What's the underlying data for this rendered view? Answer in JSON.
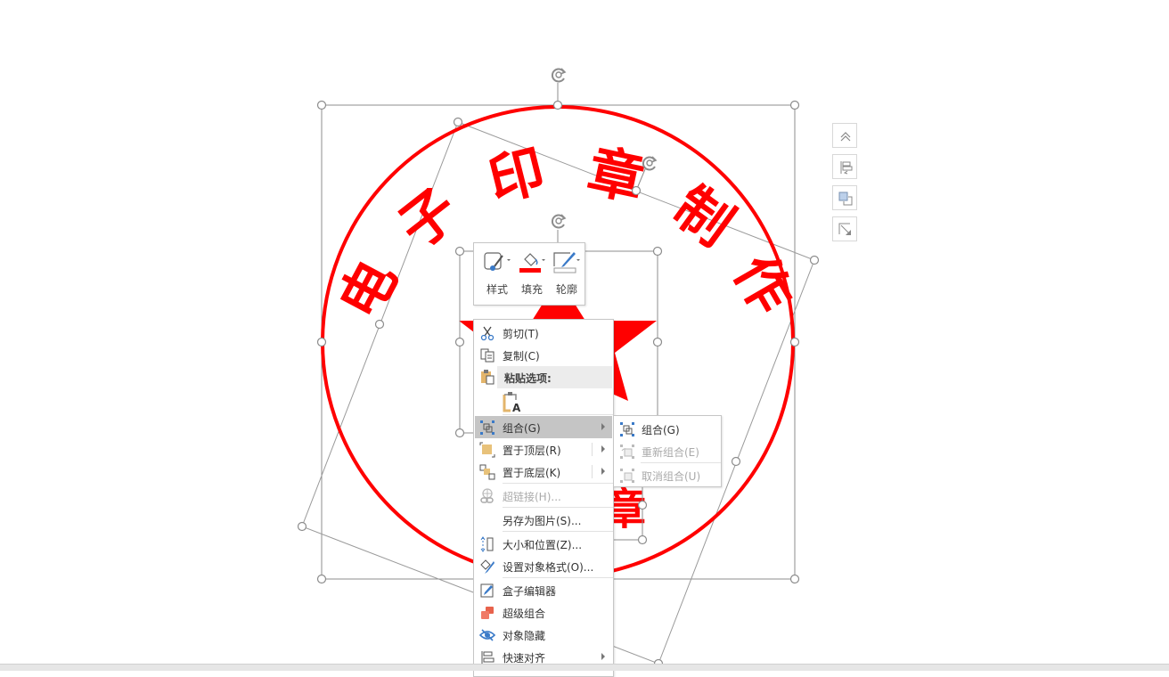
{
  "stamp": {
    "arc_text": [
      "电",
      "子",
      "印",
      "章",
      "制",
      "作"
    ],
    "center_text_partial": "章",
    "color": "#ff0000"
  },
  "mini_toolbar": {
    "buttons": [
      {
        "label": "样式",
        "icon": "shape-style-icon"
      },
      {
        "label": "填充",
        "icon": "fill-bucket-icon",
        "color": "#ff0000"
      },
      {
        "label": "轮廓",
        "icon": "outline-pen-icon"
      }
    ]
  },
  "context_menu": {
    "items": [
      {
        "label": "剪切(T)",
        "icon": "scissors-icon"
      },
      {
        "label": "复制(C)",
        "icon": "copy-icon"
      },
      {
        "label": "粘贴选项:",
        "icon": "paste-icon",
        "header": true
      },
      {
        "label": "",
        "icon": "paste-text-only-icon"
      },
      {
        "label": "组合(G)",
        "icon": "group-icon",
        "submenu": true,
        "highlighted": true
      },
      {
        "label": "置于顶层(R)",
        "icon": "bring-to-front-icon",
        "submenu": true
      },
      {
        "label": "置于底层(K)",
        "icon": "send-to-back-icon",
        "submenu": true
      },
      {
        "label": "超链接(H)...",
        "icon": "hyperlink-icon",
        "disabled": true
      },
      {
        "label": "另存为图片(S)...",
        "icon": ""
      },
      {
        "label": "大小和位置(Z)...",
        "icon": "size-position-icon"
      },
      {
        "label": "设置对象格式(O)...",
        "icon": "format-object-icon"
      },
      {
        "label": "盒子编辑器",
        "icon": "box-editor-icon"
      },
      {
        "label": "超级组合",
        "icon": "super-group-icon"
      },
      {
        "label": "对象隐藏",
        "icon": "hide-object-icon"
      },
      {
        "label": "快速对齐",
        "icon": "quick-align-icon",
        "submenu": true
      }
    ]
  },
  "group_submenu": {
    "items": [
      {
        "label": "组合(G)",
        "icon": "group-icon"
      },
      {
        "label": "重新组合(E)",
        "icon": "regroup-icon",
        "disabled": true
      },
      {
        "label": "取消组合(U)",
        "icon": "ungroup-icon",
        "disabled": true
      }
    ]
  },
  "side_tools": [
    {
      "name": "collapse-icon"
    },
    {
      "name": "layout-options-icon"
    },
    {
      "name": "wrap-text-icon"
    },
    {
      "name": "resize-icon"
    }
  ]
}
